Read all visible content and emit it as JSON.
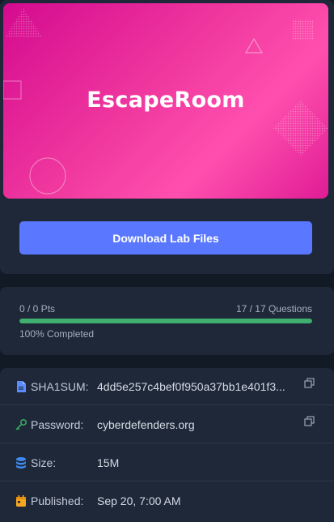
{
  "banner": {
    "title": "EscapeRoom"
  },
  "actions": {
    "download_label": "Download Lab Files"
  },
  "progress": {
    "points": "0 / 0 Pts",
    "questions": "17 / 17 Questions",
    "completed_label": "100% Completed",
    "fraction": 1.0
  },
  "info": {
    "sha1": {
      "label": "SHA1SUM:",
      "value": "4dd5e257c4bef0f950a37bb1e401f3..."
    },
    "password": {
      "label": "Password:",
      "value": "cyberdefenders.org"
    },
    "size": {
      "label": "Size:",
      "value": "15M"
    },
    "published": {
      "label": "Published:",
      "value": "Sep 20, 7:00 AM"
    }
  },
  "colors": {
    "accent": "#5a78ff",
    "progress": "#3fae6e",
    "banner": "#ec3aa0",
    "sha_icon": "#5b8cff",
    "key_icon": "#3ca85f",
    "db_icon": "#3d8bf0",
    "calendar_icon": "#f5a623"
  },
  "icons": [
    "file-icon",
    "key-icon",
    "database-icon",
    "calendar-icon",
    "copy-icon"
  ]
}
